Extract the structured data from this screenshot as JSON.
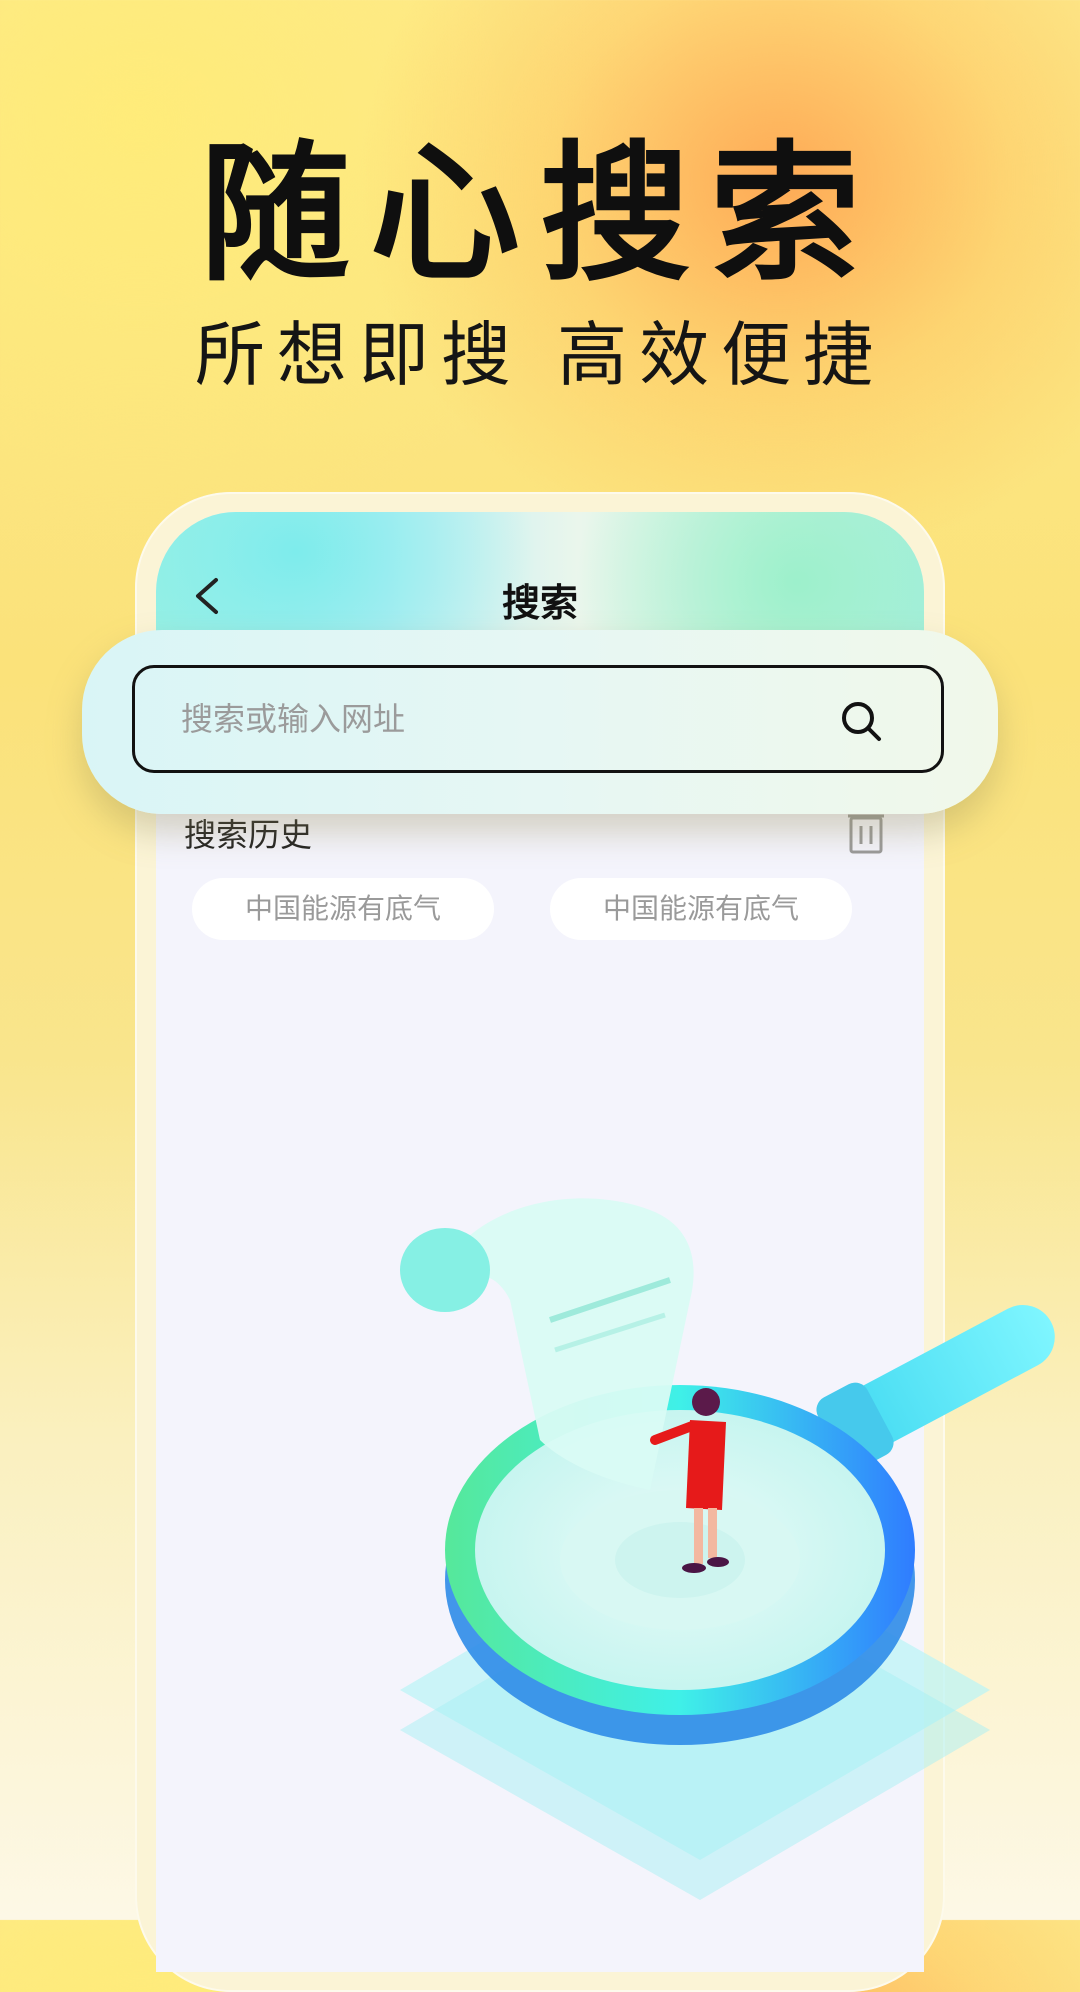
{
  "promo": {
    "headline": "随心搜索",
    "subline": "所想即搜 高效便捷"
  },
  "screen": {
    "title": "搜索",
    "search": {
      "placeholder": "搜索或输入网址"
    },
    "history": {
      "label": "搜索历史",
      "items": [
        "中国能源有底气",
        "中国能源有底气"
      ]
    }
  },
  "icons": {
    "back": "chevron-left-icon",
    "search": "search-icon",
    "trash": "trash-icon"
  },
  "colors": {
    "accent_cyan": "#3ff0e8",
    "accent_blue": "#2f7cff",
    "figure_red": "#e61a1a"
  }
}
